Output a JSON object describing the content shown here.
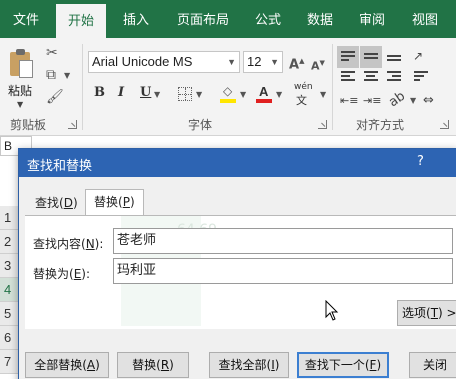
{
  "ribbon_tabs": [
    {
      "label": "文件"
    },
    {
      "label": "开始"
    },
    {
      "label": "插入"
    },
    {
      "label": "页面布局"
    },
    {
      "label": "公式"
    },
    {
      "label": "数据"
    },
    {
      "label": "审阅"
    },
    {
      "label": "视图"
    }
  ],
  "clipboard": {
    "paste_label": "粘贴",
    "group_label": "剪贴板"
  },
  "font": {
    "name": "Arial Unicode MS",
    "size": "12",
    "bold": "B",
    "italic": "I",
    "underline": "U",
    "wen_label": "wén",
    "group_label": "字体"
  },
  "alignment": {
    "group_label": "对齐方式"
  },
  "sheet": {
    "name_box": "B",
    "rows": [
      "1",
      "2",
      "3",
      "4",
      "5",
      "6",
      "7"
    ],
    "selected_row": "4",
    "ghost_value": "64.69"
  },
  "dialog": {
    "title": "查找和替换",
    "help": "?",
    "tabs": [
      {
        "label": "查找(",
        "key": "D",
        "suffix": ")"
      },
      {
        "label": "替换(",
        "key": "P",
        "suffix": ")"
      }
    ],
    "find_label": {
      "label": "查找内容(",
      "key": "N",
      "suffix": "):"
    },
    "find_value": "苍老师",
    "replace_label": {
      "label": "替换为(",
      "key": "E",
      "suffix": "):"
    },
    "replace_value": "玛利亚",
    "options_button": {
      "label": "选项(",
      "key": "T",
      "suffix": ") >"
    },
    "buttons": [
      {
        "label": "全部替换(",
        "key": "A",
        "suffix": ")"
      },
      {
        "label": "替换(",
        "key": "R",
        "suffix": ")"
      },
      {
        "label": "查找全部(",
        "key": "I",
        "suffix": ")"
      },
      {
        "label": "查找下一个(",
        "key": "F",
        "suffix": ")"
      },
      {
        "label": "关闭",
        "key": "",
        "suffix": ""
      }
    ]
  },
  "colors": {
    "excel_green": "#217346",
    "dialog_title": "#2d64b3",
    "highlight_yellow": "#ffe600",
    "font_red": "#e02020"
  }
}
